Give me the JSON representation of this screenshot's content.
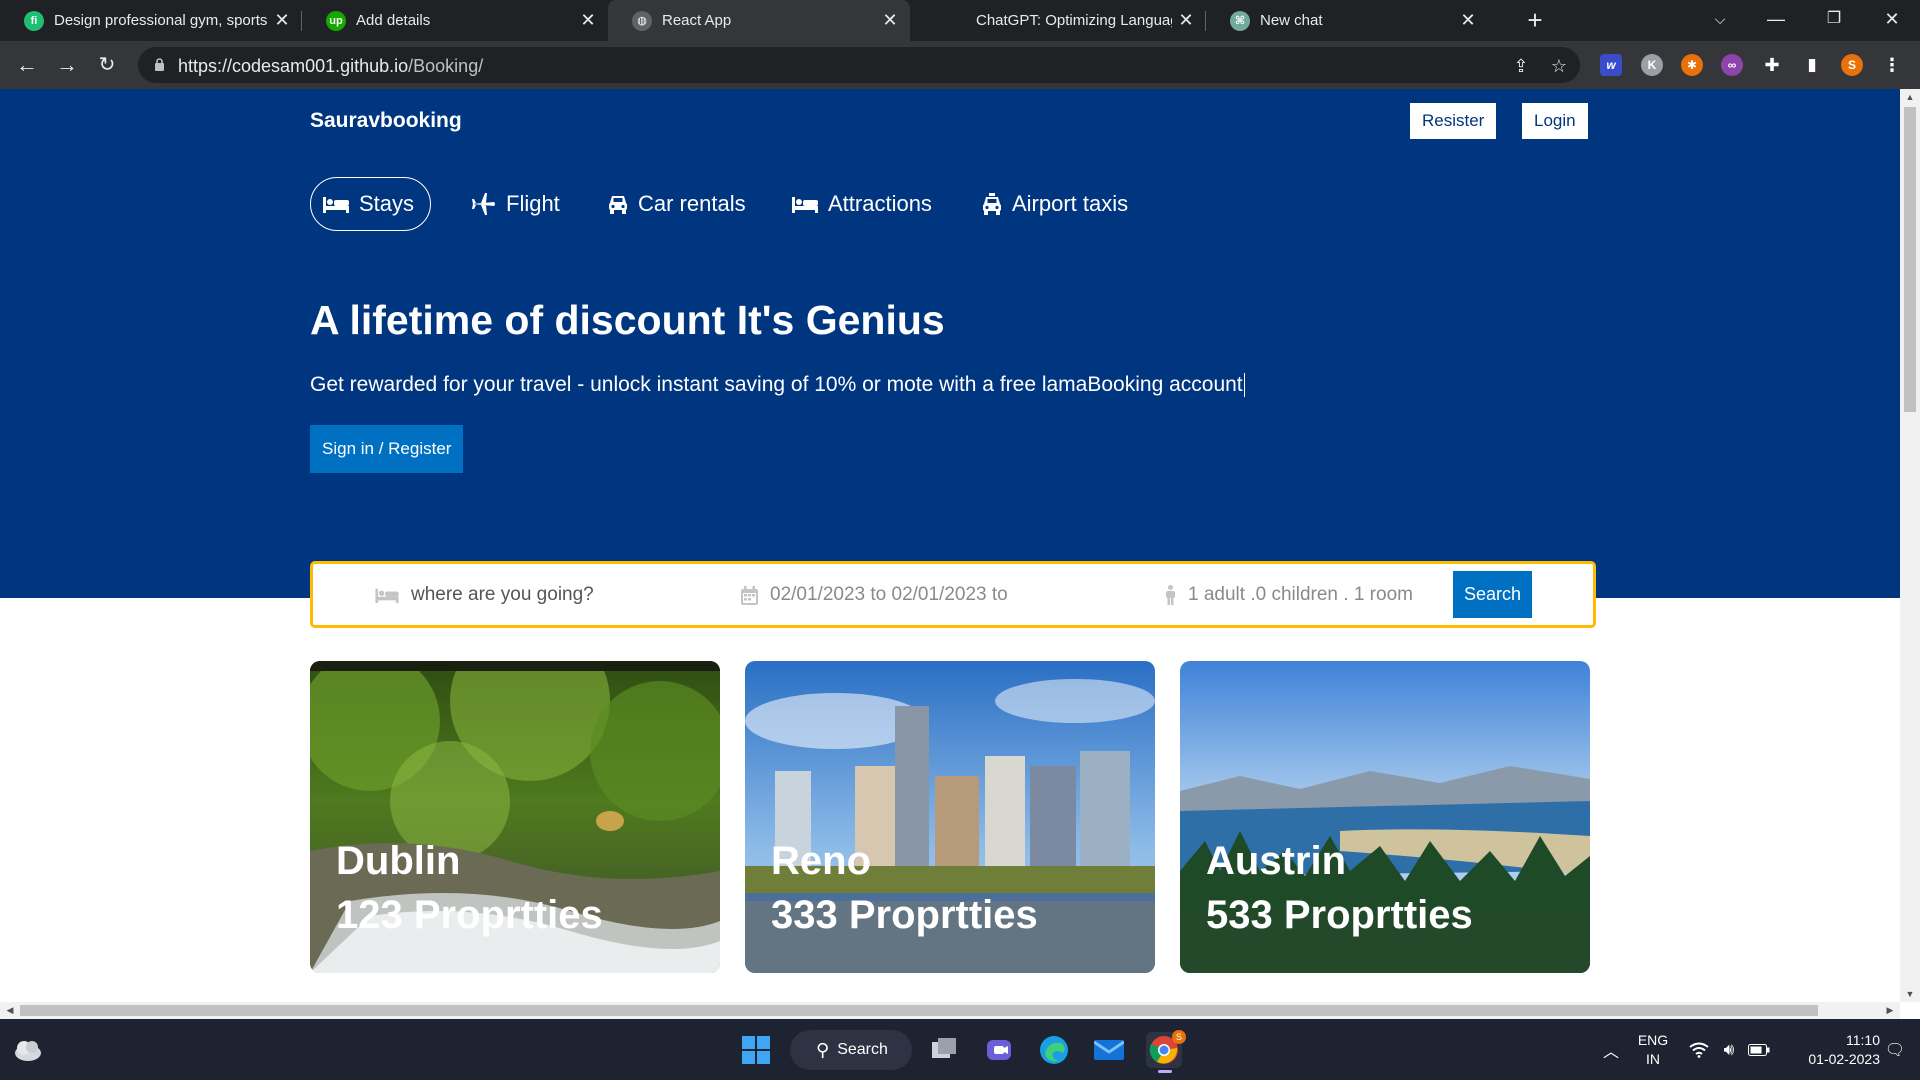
{
  "browser": {
    "tabs": [
      {
        "title": "Design professional gym, sports, an",
        "icon": "fiverr-icon",
        "active": false
      },
      {
        "title": "Add details",
        "icon": "upwork-icon",
        "active": false
      },
      {
        "title": "React App",
        "icon": "globe-icon",
        "active": true
      },
      {
        "title": "ChatGPT: Optimizing Language Mo",
        "icon": "chatgpt-icon",
        "active": false
      },
      {
        "title": "New chat",
        "icon": "chatgpt-icon",
        "active": false
      }
    ],
    "url_host": "https://codesam001.github.io",
    "url_path": "/Booking/",
    "profile_initial": "S",
    "ext_k": "K"
  },
  "page": {
    "brand": "Sauravbooking",
    "register_label": "Resister",
    "login_label": "Login",
    "categories": [
      {
        "label": "Stays",
        "icon": "bed-icon"
      },
      {
        "label": "Flight",
        "icon": "plane-icon"
      },
      {
        "label": "Car rentals",
        "icon": "car-icon"
      },
      {
        "label": "Attractions",
        "icon": "bed-icon"
      },
      {
        "label": "Airport taxis",
        "icon": "taxi-icon"
      }
    ],
    "hero_title": "A lifetime of discount It's Genius",
    "hero_desc": "Get rewarded for your travel - unlock instant saving of 10% or mote with a free lamaBooking account",
    "hero_button": "Sign in / Register",
    "search": {
      "destination_placeholder": "where are you going?",
      "dates": "02/01/2023 to 02/01/2023 to",
      "guests": "1 adult .0 children . 1 room",
      "button": "Search"
    },
    "featured": [
      {
        "city": "Dublin",
        "count": "123 Proprtties"
      },
      {
        "city": "Reno",
        "count": "333 Proprtties"
      },
      {
        "city": "Austrin",
        "count": "533 Proprtties"
      }
    ]
  },
  "taskbar": {
    "search_label": "Search",
    "lang_line1": "ENG",
    "lang_line2": "IN",
    "time": "11:10",
    "date": "01-02-2023"
  },
  "colors": {
    "brand_blue": "#003580",
    "button_blue": "#0071c2",
    "search_border": "#febb02"
  }
}
